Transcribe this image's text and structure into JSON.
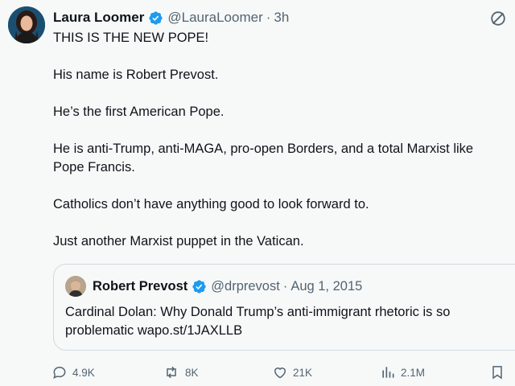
{
  "tweet": {
    "author_name": "Laura Loomer",
    "handle": "@LauraLoomer",
    "separator": "·",
    "time": "3h",
    "lines": [
      "THIS IS THE NEW POPE!",
      "",
      "His name is Robert Prevost.",
      "",
      "He’s the first American Pope.",
      "",
      "He is anti-Trump, anti-MAGA, pro-open Borders, and a total Marxist like",
      "Pope Francis.",
      "",
      "Catholics don’t have anything good to look forward to.",
      "",
      "Just another Marxist puppet in the Vatican."
    ]
  },
  "quote": {
    "author_name": "Robert Prevost",
    "handle": "@drprevost",
    "separator": "·",
    "date": "Aug 1, 2015",
    "line1": "Cardinal Dolan: Why Donald Trump’s anti-immigrant rhetoric is so",
    "line2": "problematic wapo.st/1JAXLLB"
  },
  "actions": {
    "replies": "4.9K",
    "reposts": "8K",
    "likes": "21K",
    "views": "2.1M"
  },
  "colors": {
    "verified": "#1d9bf0",
    "text": "#0f1419",
    "muted": "#536471",
    "border": "#cfd9de"
  },
  "icons": [
    "verified-badge-icon",
    "grok-icon",
    "reply-icon",
    "repost-icon",
    "like-icon",
    "views-icon",
    "bookmark-icon"
  ]
}
